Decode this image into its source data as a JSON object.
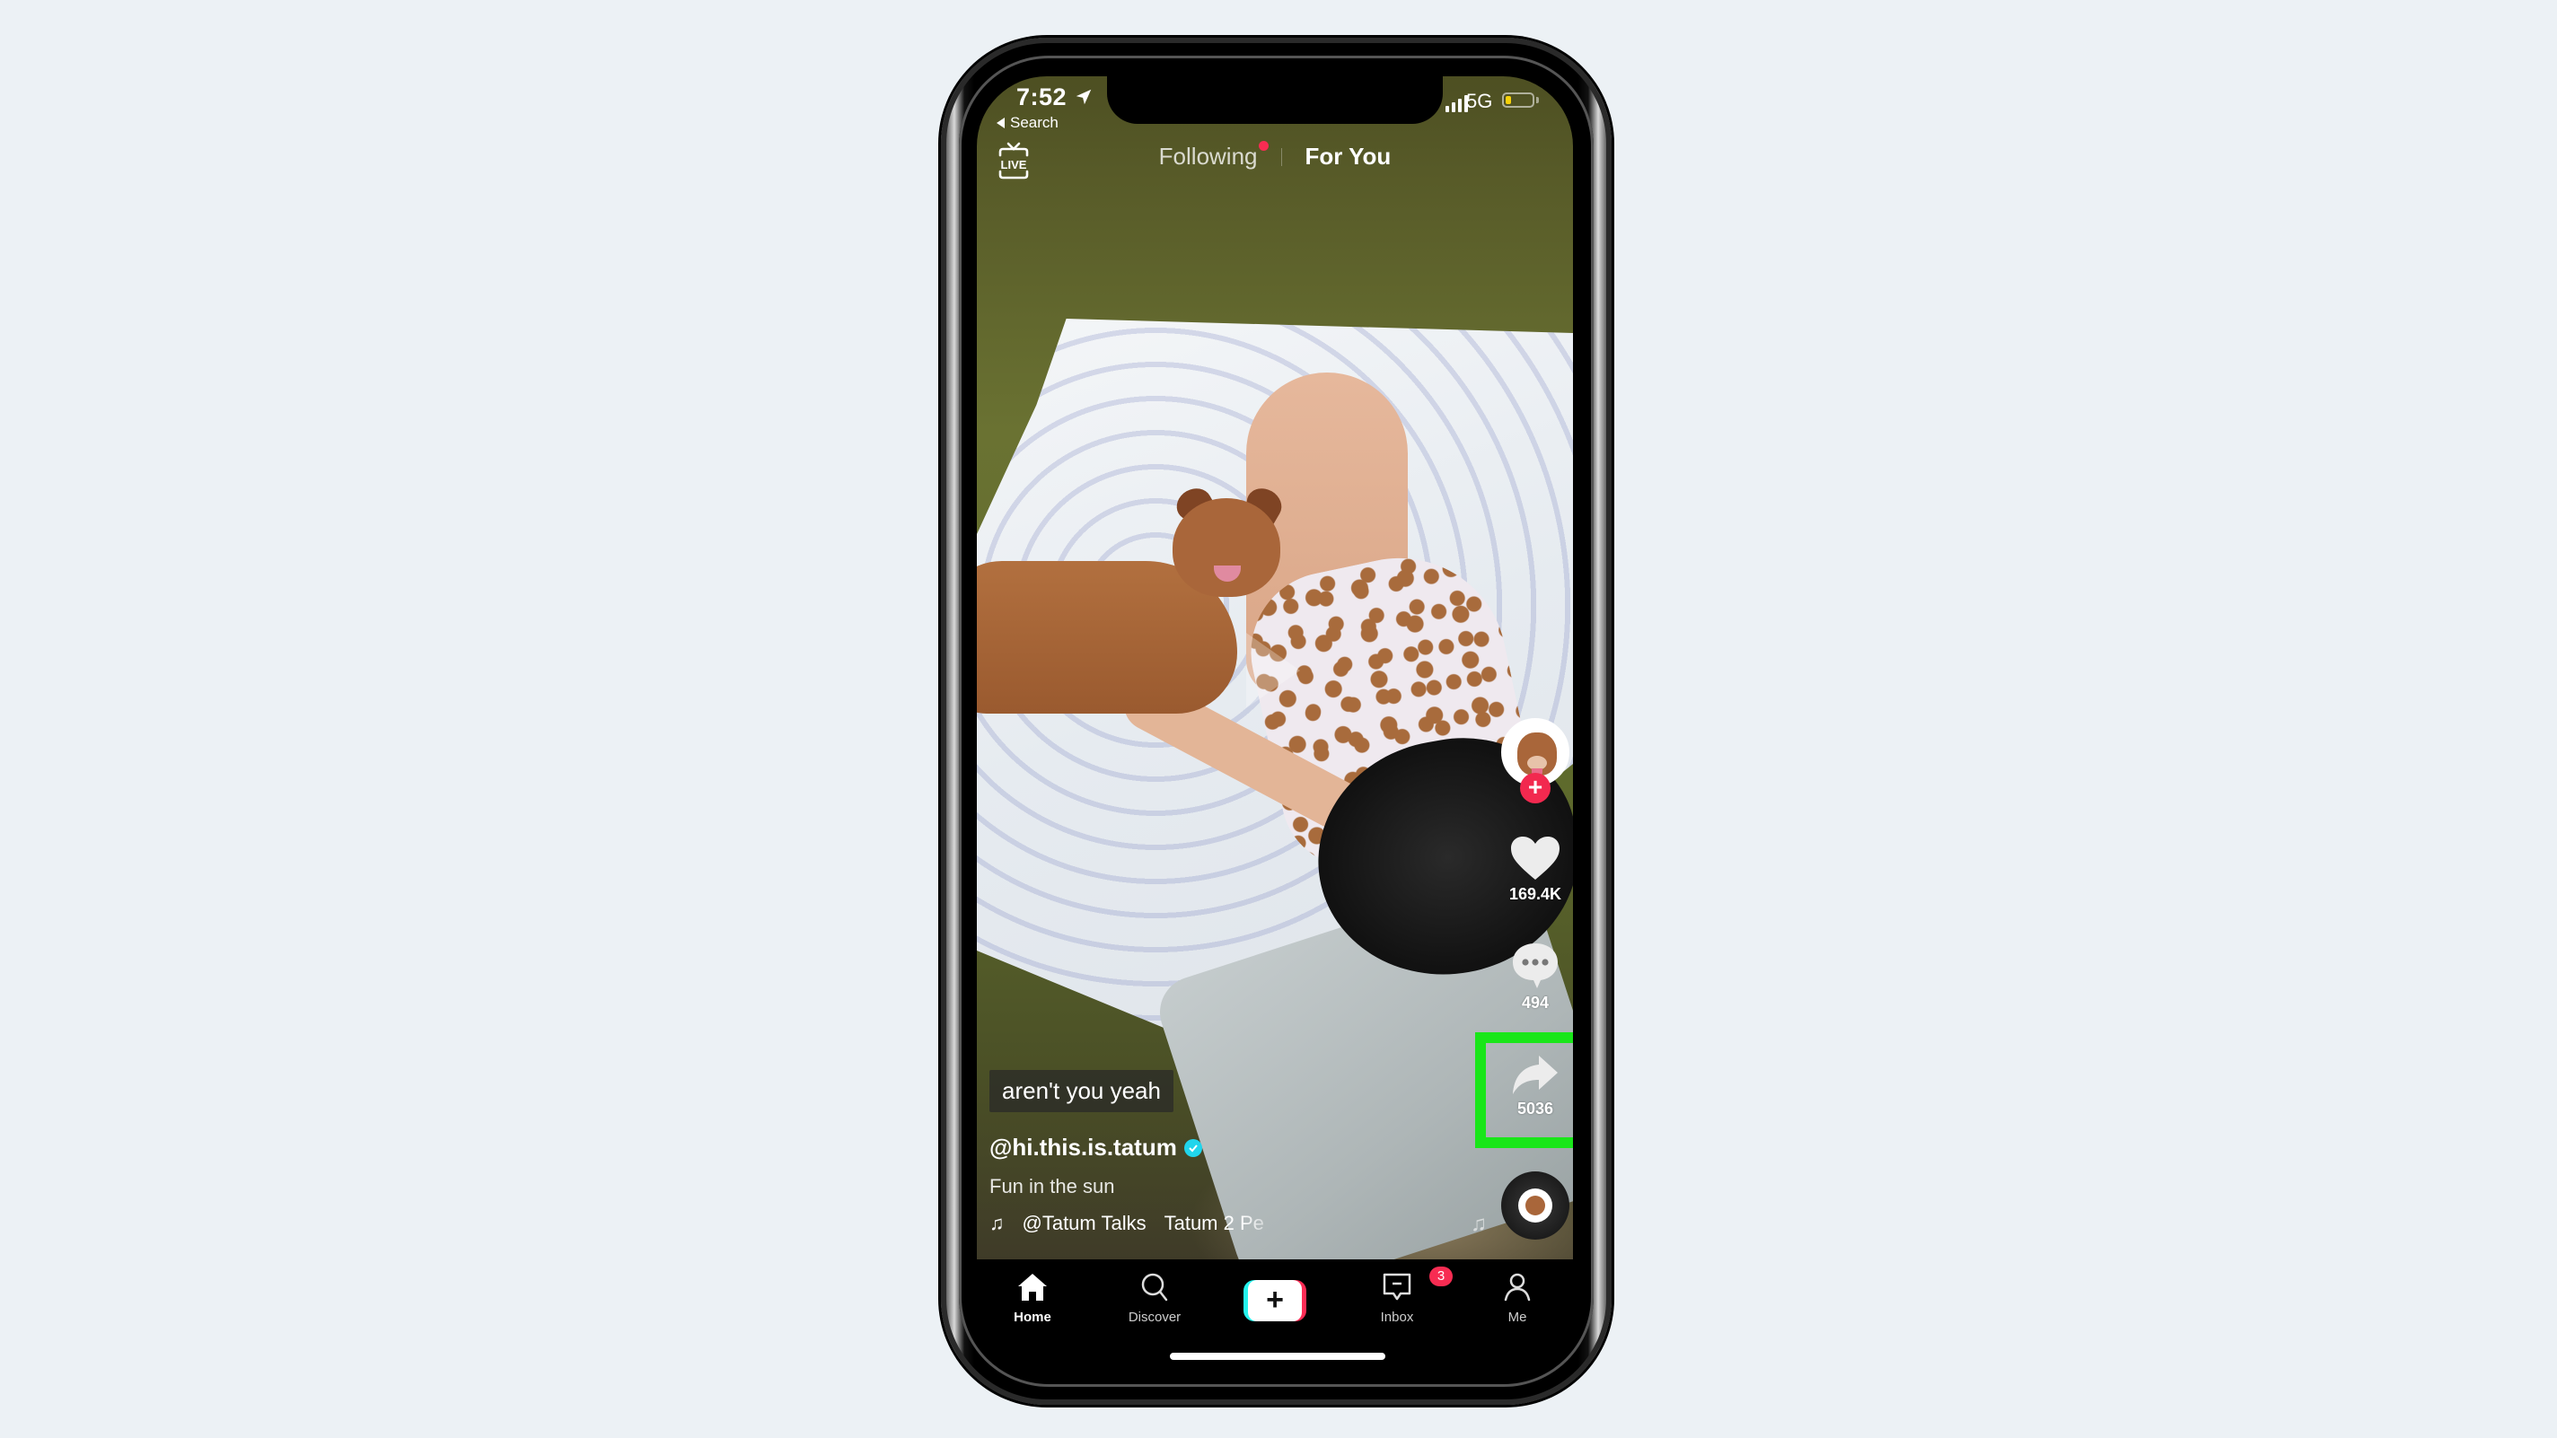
{
  "status_bar": {
    "time": "7:52",
    "back_label": "Search",
    "network": "5G",
    "battery_level_fraction": 0.2,
    "battery_color": "#f5d10a"
  },
  "top_tabs": {
    "live_label": "LIVE",
    "following": "Following",
    "for_you": "For You",
    "active": "For You",
    "following_dot_color": "#f72c52"
  },
  "video": {
    "sticker_text": "aren't you yeah",
    "username": "@hi.this.is.tatum",
    "verified": true,
    "description": "Fun in the sun",
    "music_artist": "@Tatum Talks",
    "music_title": "Tatum 2 Pe"
  },
  "actions": {
    "likes": "169.4K",
    "comments": "494",
    "shares": "5036",
    "follow_symbol": "+"
  },
  "highlight": {
    "target": "share-button",
    "color": "#19e619"
  },
  "bottom_nav": {
    "items": [
      {
        "label": "Home",
        "icon": "home-icon",
        "active": true
      },
      {
        "label": "Discover",
        "icon": "search-icon",
        "active": false
      },
      {
        "label": "",
        "icon": "create-plus-icon",
        "active": false
      },
      {
        "label": "Inbox",
        "icon": "inbox-icon",
        "active": false,
        "badge": "3"
      },
      {
        "label": "Me",
        "icon": "profile-icon",
        "active": false
      }
    ],
    "create_symbol": "+"
  },
  "colors": {
    "page_background": "#ecf1f5",
    "accent_red": "#fe2c55",
    "accent_cyan": "#25f4ee",
    "verified_blue": "#20d5ec"
  }
}
